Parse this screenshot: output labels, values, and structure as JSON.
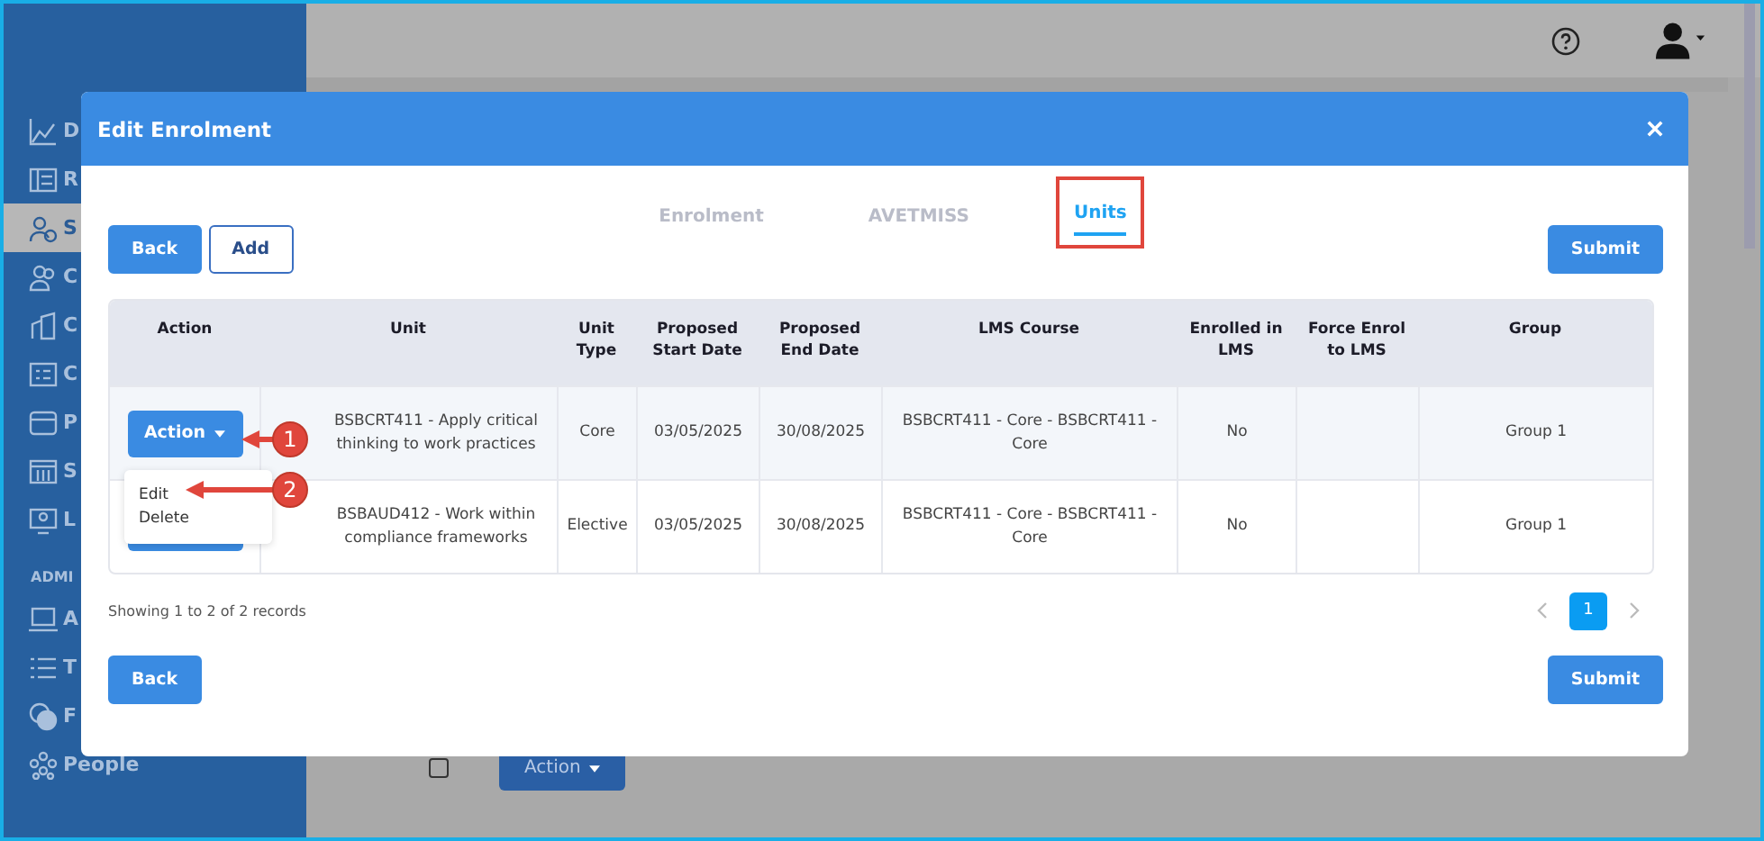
{
  "sidebar": {
    "items": [
      {
        "kind": "link",
        "label": "D",
        "selected": false
      },
      {
        "kind": "link",
        "label": "R",
        "selected": false
      },
      {
        "kind": "link",
        "label": "S",
        "selected": true
      },
      {
        "kind": "link",
        "label": "C",
        "selected": false
      },
      {
        "kind": "link",
        "label": "C",
        "selected": false
      },
      {
        "kind": "link",
        "label": "C",
        "selected": false
      },
      {
        "kind": "link",
        "label": "P",
        "selected": false
      },
      {
        "kind": "link",
        "label": "S",
        "selected": false
      },
      {
        "kind": "link",
        "label": "L",
        "selected": false
      },
      {
        "kind": "heading",
        "label": "ADMI"
      },
      {
        "kind": "link",
        "label": "A",
        "selected": false
      },
      {
        "kind": "link",
        "label": "T",
        "selected": false
      },
      {
        "kind": "link",
        "label": "F",
        "selected": false
      },
      {
        "kind": "link",
        "label": "People",
        "selected": false
      }
    ]
  },
  "background_table": {
    "rows": [
      {
        "checked": false,
        "action": "Action"
      }
    ]
  },
  "modal": {
    "title": "Edit Enrolment",
    "tabs": [
      {
        "label": "Enrolment",
        "selected": false,
        "highlighted": false
      },
      {
        "label": "AVETMISS",
        "selected": false,
        "highlighted": false
      },
      {
        "label": "Units",
        "selected": true,
        "highlighted": true
      }
    ],
    "top_buttons": [
      {
        "label": "Back",
        "kind": "primary"
      },
      {
        "label": "Add",
        "kind": "outline"
      }
    ],
    "submit": "Submit",
    "table": {
      "columns": [
        "Action",
        "Unit",
        "Unit Type",
        "Proposed Start Date",
        "Proposed End Date",
        "LMS Course",
        "Enrolled in LMS",
        "Force Enrol to LMS",
        "Group"
      ],
      "rows": [
        {
          "action": "Action",
          "unit": "BSBCRT411 - Apply critical thinking to work practices",
          "unit_type": "Core",
          "start": "03/05/2025",
          "end": "30/08/2025",
          "lms_course": "BSBCRT411 - Core - BSBCRT411 - Core",
          "enrolled": "No",
          "group": "Group 1",
          "menu": [
            "Edit",
            "Delete"
          ]
        },
        {
          "unit": "BSBAUD412 - Work within compliance frameworks",
          "unit_type": "Elective",
          "start": "03/05/2025",
          "end": "30/08/2025",
          "lms_course": "BSBCRT411 - Core - BSBCRT411 - Core",
          "enrolled": "No",
          "group": "Group 1"
        }
      ]
    },
    "info": "Showing 1 to 2 of 2 records",
    "pages": [
      {
        "label": "1",
        "selected": true
      }
    ],
    "bottom_buttons": {
      "back": "Back",
      "submit": "Submit"
    }
  },
  "callouts": [
    {
      "number": "1"
    },
    {
      "number": "2"
    }
  ]
}
